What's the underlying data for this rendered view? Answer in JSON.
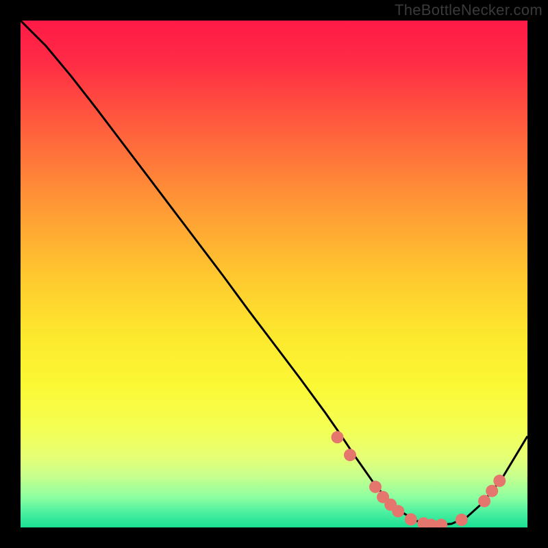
{
  "watermark": "TheBottleNecker.com",
  "chart_data": {
    "type": "line",
    "title": "",
    "xlabel": "",
    "ylabel": "",
    "xlim": [
      0,
      1
    ],
    "ylim": [
      0,
      1
    ],
    "grid": false,
    "description": "Bottleneck curve over a vertical red-to-green gradient background; lower values (green zone) indicate minimal bottleneck.",
    "series": [
      {
        "name": "bottleneck-curve",
        "color": "#000000",
        "x": [
          0.0,
          0.02,
          0.05,
          0.1,
          0.15,
          0.2,
          0.25,
          0.3,
          0.35,
          0.4,
          0.45,
          0.5,
          0.55,
          0.6,
          0.63,
          0.66,
          0.7,
          0.74,
          0.78,
          0.82,
          0.85,
          0.88,
          0.91,
          0.95,
          1.0
        ],
        "values": [
          1.0,
          0.98,
          0.95,
          0.89,
          0.826,
          0.76,
          0.694,
          0.628,
          0.562,
          0.496,
          0.428,
          0.362,
          0.296,
          0.228,
          0.185,
          0.14,
          0.083,
          0.038,
          0.013,
          0.005,
          0.007,
          0.02,
          0.047,
          0.097,
          0.18
        ]
      }
    ],
    "highlight_points": {
      "name": "near-minimum markers",
      "color": "#e4766d",
      "points": [
        {
          "x": 0.625,
          "y": 0.178
        },
        {
          "x": 0.65,
          "y": 0.143
        },
        {
          "x": 0.7,
          "y": 0.08
        },
        {
          "x": 0.715,
          "y": 0.06
        },
        {
          "x": 0.73,
          "y": 0.045
        },
        {
          "x": 0.745,
          "y": 0.032
        },
        {
          "x": 0.77,
          "y": 0.016
        },
        {
          "x": 0.795,
          "y": 0.008
        },
        {
          "x": 0.81,
          "y": 0.005
        },
        {
          "x": 0.83,
          "y": 0.005
        },
        {
          "x": 0.87,
          "y": 0.015
        },
        {
          "x": 0.915,
          "y": 0.052
        },
        {
          "x": 0.93,
          "y": 0.072
        },
        {
          "x": 0.945,
          "y": 0.092
        }
      ]
    },
    "gradient_stops": [
      {
        "pos": 0.0,
        "color": "#ff1a47"
      },
      {
        "pos": 0.08,
        "color": "#ff2b45"
      },
      {
        "pos": 0.2,
        "color": "#ff5a3e"
      },
      {
        "pos": 0.35,
        "color": "#ff9336"
      },
      {
        "pos": 0.5,
        "color": "#ffc72f"
      },
      {
        "pos": 0.62,
        "color": "#fde82e"
      },
      {
        "pos": 0.72,
        "color": "#fbf835"
      },
      {
        "pos": 0.8,
        "color": "#f5ff52"
      },
      {
        "pos": 0.86,
        "color": "#e6ff74"
      },
      {
        "pos": 0.9,
        "color": "#c6ff8e"
      },
      {
        "pos": 0.94,
        "color": "#8effa0"
      },
      {
        "pos": 0.97,
        "color": "#4cf0a0"
      },
      {
        "pos": 1.0,
        "color": "#1adf93"
      }
    ]
  }
}
